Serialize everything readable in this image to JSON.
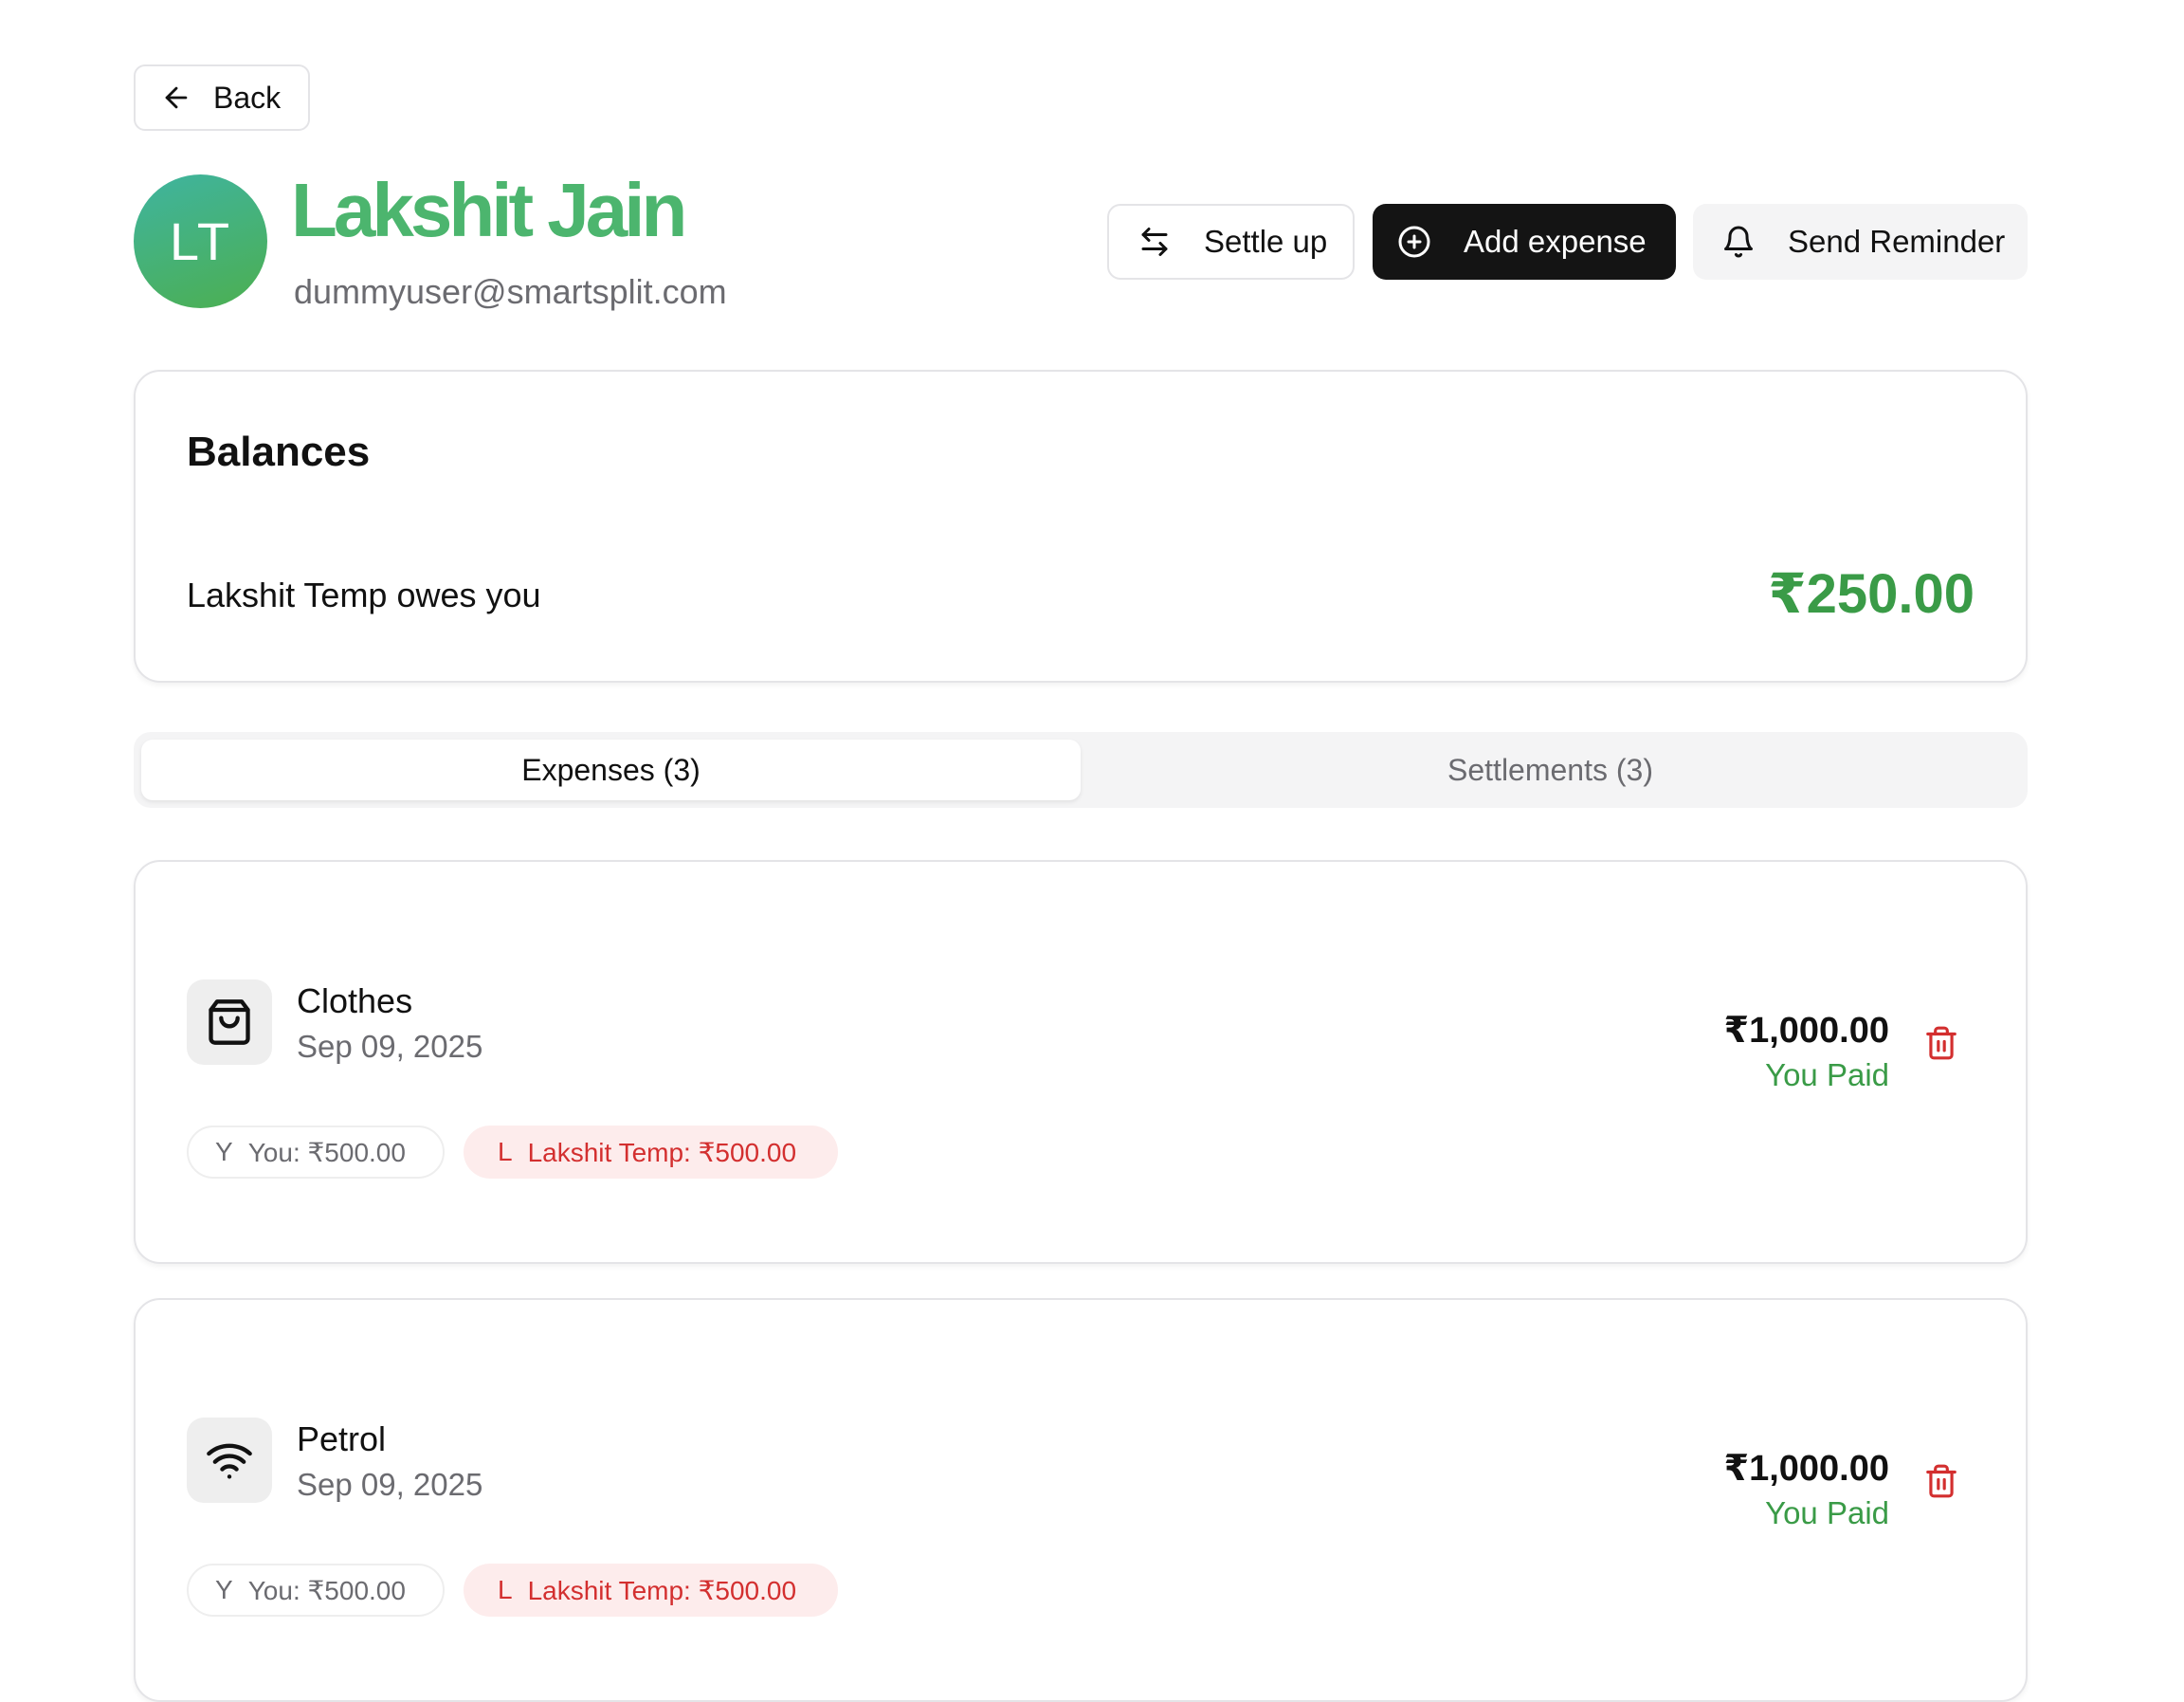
{
  "back": {
    "label": "Back"
  },
  "user": {
    "initials": "LT",
    "name": "Lakshit Jain",
    "email": "dummyuser@smartsplit.com"
  },
  "actions": {
    "settle_up": "Settle up",
    "add_expense": "Add expense",
    "send_reminder": "Send Reminder"
  },
  "balances": {
    "title": "Balances",
    "row": {
      "label": "Lakshit Temp owes you",
      "amount": "₹250.00"
    }
  },
  "tabs": [
    {
      "label": "Expenses (3)",
      "active": true
    },
    {
      "label": "Settlements (3)",
      "active": false
    }
  ],
  "expenses": [
    {
      "title": "Clothes",
      "date": "Sep 09, 2025",
      "amount": "₹1,000.00",
      "status": "You Paid",
      "icon": "shopping-bag-icon",
      "split_you": {
        "initial": "Y",
        "text": "You: ₹500.00"
      },
      "split_other": {
        "initial": "L",
        "text": "Lakshit Temp: ₹500.00"
      }
    },
    {
      "title": "Petrol",
      "date": "Sep 09, 2025",
      "amount": "₹1,000.00",
      "status": "You Paid",
      "icon": "wifi-icon",
      "split_you": {
        "initial": "Y",
        "text": "You: ₹500.00"
      },
      "split_other": {
        "initial": "L",
        "text": "Lakshit Temp: ₹500.00"
      }
    }
  ],
  "colors": {
    "brand_green": "#4cb56e",
    "positive": "#3a9b47",
    "danger": "#d32f2f",
    "primary_button": "#141414"
  }
}
